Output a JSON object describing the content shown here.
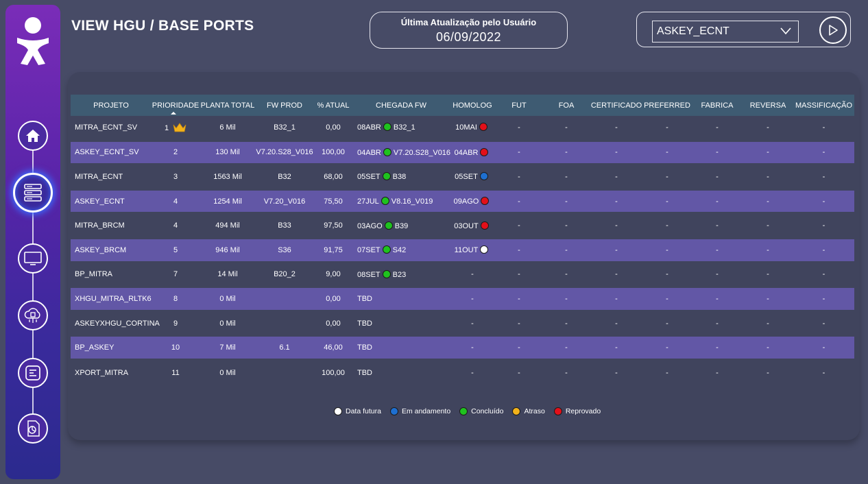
{
  "header": {
    "title": "VIEW HGU / BASE PORTS",
    "update_label": "Última Atualização pelo Usuário",
    "update_date": "06/09/2022",
    "filter_value": "ASKEY_ECNT"
  },
  "sidebar": {
    "items": [
      {
        "name": "home",
        "icon": "home-icon"
      },
      {
        "name": "server",
        "icon": "server-icon",
        "active": true
      },
      {
        "name": "monitor",
        "icon": "monitor-icon"
      },
      {
        "name": "cloud-chip",
        "icon": "cloud-chip-icon"
      },
      {
        "name": "checklist",
        "icon": "checklist-icon"
      },
      {
        "name": "report",
        "icon": "report-icon"
      }
    ]
  },
  "colors": {
    "concluido": "#1fc21f",
    "andamento": "#1e6fd0",
    "futura": "#ffffff",
    "atraso": "#f2b21b",
    "reprovado": "#e3101a",
    "row_alt": "#6257a6",
    "header_row": "#3e5b72"
  },
  "table": {
    "headers": [
      "PROJETO",
      "PRIORIDADE",
      "PLANTA TOTAL",
      "FW PROD",
      "% ATUAL",
      "CHEGADA FW",
      "HOMOLOG",
      "FUT",
      "FOA",
      "CERTIFICADO",
      "PREFERRED",
      "FABRICA",
      "REVERSA",
      "MASSIFICAÇÃO"
    ],
    "rows": [
      {
        "projeto": "MITRA_ECNT_SV",
        "prioridade": "1",
        "crown": true,
        "planta": "6 Mil",
        "fw_prod": "B32_1",
        "atual": "0,00",
        "chegada_date": "08ABR",
        "chegada_status": "concluido",
        "chegada_fw": "B32_1",
        "homolog": "10MAI",
        "homolog_status": "reprovado",
        "fut": "-",
        "foa": "-",
        "cert": "-",
        "pref": "-",
        "fab": "-",
        "rev": "-",
        "mass": "-"
      },
      {
        "projeto": "ASKEY_ECNT_SV",
        "prioridade": "2",
        "planta": "130 Mil",
        "fw_prod": "V7.20.S28_V016",
        "atual": "100,00",
        "chegada_date": "04ABR",
        "chegada_status": "concluido",
        "chegada_fw": "V7.20.S28_V016",
        "homolog": "04ABR",
        "homolog_status": "reprovado",
        "fut": "-",
        "foa": "-",
        "cert": "-",
        "pref": "-",
        "fab": "-",
        "rev": "-",
        "mass": "-"
      },
      {
        "projeto": "MITRA_ECNT",
        "prioridade": "3",
        "planta": "1563 Mil",
        "fw_prod": "B32",
        "atual": "68,00",
        "chegada_date": "05SET",
        "chegada_status": "concluido",
        "chegada_fw": "B38",
        "homolog": "05SET",
        "homolog_status": "andamento",
        "fut": "-",
        "foa": "-",
        "cert": "-",
        "pref": "-",
        "fab": "-",
        "rev": "-",
        "mass": "-"
      },
      {
        "projeto": "ASKEY_ECNT",
        "prioridade": "4",
        "planta": "1254 Mil",
        "fw_prod": "V7.20_V016",
        "atual": "75,50",
        "chegada_date": "27JUL",
        "chegada_status": "concluido",
        "chegada_fw": "V8.16_V019",
        "homolog": "09AGO",
        "homolog_status": "reprovado",
        "fut": "-",
        "foa": "-",
        "cert": "-",
        "pref": "-",
        "fab": "-",
        "rev": "-",
        "mass": "-"
      },
      {
        "projeto": "MITRA_BRCM",
        "prioridade": "4",
        "planta": "494 Mil",
        "fw_prod": "B33",
        "atual": "97,50",
        "chegada_date": "03AGO",
        "chegada_status": "concluido",
        "chegada_fw": "B39",
        "homolog": "03OUT",
        "homolog_status": "reprovado",
        "fut": "-",
        "foa": "-",
        "cert": "-",
        "pref": "-",
        "fab": "-",
        "rev": "-",
        "mass": "-"
      },
      {
        "projeto": "ASKEY_BRCM",
        "prioridade": "5",
        "planta": "946 Mil",
        "fw_prod": "S36",
        "atual": "91,75",
        "chegada_date": "07SET",
        "chegada_status": "concluido",
        "chegada_fw": "S42",
        "homolog": "11OUT",
        "homolog_status": "futura",
        "fut": "-",
        "foa": "-",
        "cert": "-",
        "pref": "-",
        "fab": "-",
        "rev": "-",
        "mass": "-"
      },
      {
        "projeto": "BP_MITRA",
        "prioridade": "7",
        "planta": "14 Mil",
        "fw_prod": "B20_2",
        "atual": "9,00",
        "chegada_date": "08SET",
        "chegada_status": "concluido",
        "chegada_fw": "B23",
        "homolog": "-",
        "homolog_status": "",
        "fut": "-",
        "foa": "-",
        "cert": "-",
        "pref": "-",
        "fab": "-",
        "rev": "-",
        "mass": "-"
      },
      {
        "projeto": "XHGU_MITRA_RLTK6",
        "prioridade": "8",
        "planta": "0 Mil",
        "fw_prod": "",
        "atual": "0,00",
        "chegada_date": "TBD",
        "chegada_status": "",
        "chegada_fw": "",
        "homolog": "-",
        "homolog_status": "",
        "fut": "-",
        "foa": "-",
        "cert": "-",
        "pref": "-",
        "fab": "-",
        "rev": "-",
        "mass": "-"
      },
      {
        "projeto": "ASKEYXHGU_CORTINA",
        "prioridade": "9",
        "planta": "0 Mil",
        "fw_prod": "",
        "atual": "0,00",
        "chegada_date": "TBD",
        "chegada_status": "",
        "chegada_fw": "",
        "homolog": "-",
        "homolog_status": "",
        "fut": "-",
        "foa": "-",
        "cert": "-",
        "pref": "-",
        "fab": "-",
        "rev": "-",
        "mass": "-"
      },
      {
        "projeto": "BP_ASKEY",
        "prioridade": "10",
        "planta": "7 Mil",
        "fw_prod": "6.1",
        "atual": "46,00",
        "chegada_date": "TBD",
        "chegada_status": "",
        "chegada_fw": "",
        "homolog": "-",
        "homolog_status": "",
        "fut": "-",
        "foa": "-",
        "cert": "-",
        "pref": "-",
        "fab": "-",
        "rev": "-",
        "mass": "-"
      },
      {
        "projeto": "XPORT_MITRA",
        "prioridade": "11",
        "planta": "0 Mil",
        "fw_prod": "",
        "atual": "100,00",
        "chegada_date": "TBD",
        "chegada_status": "",
        "chegada_fw": "",
        "homolog": "-",
        "homolog_status": "",
        "fut": "-",
        "foa": "-",
        "cert": "-",
        "pref": "-",
        "fab": "-",
        "rev": "-",
        "mass": "-"
      }
    ]
  },
  "legend": [
    {
      "label": "Data futura",
      "status": "futura"
    },
    {
      "label": "Em andamento",
      "status": "andamento"
    },
    {
      "label": "Concluído",
      "status": "concluido"
    },
    {
      "label": "Atraso",
      "status": "atraso"
    },
    {
      "label": "Reprovado",
      "status": "reprovado"
    }
  ]
}
